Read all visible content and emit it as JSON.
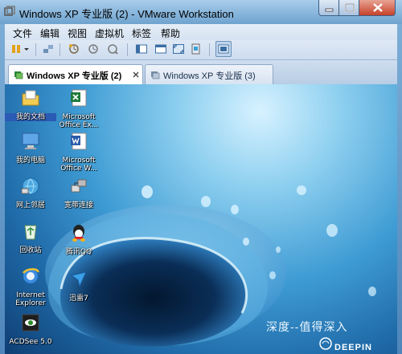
{
  "window": {
    "title": "Windows XP 专业版 (2) - VMware Workstation",
    "controls": {
      "minimize": "minimize",
      "maximize": "maximize",
      "close": "close"
    }
  },
  "menubar": {
    "items": [
      "文件",
      "编辑",
      "视图",
      "虚拟机",
      "标签",
      "帮助"
    ]
  },
  "toolbar": {
    "icons": [
      "power-icon",
      "dropdown-arrow-icon",
      "network-icon",
      "snapshot-take-icon",
      "snapshot-revert-icon",
      "snapshot-manager-icon",
      "normal-view-icon",
      "quick-switch-icon",
      "full-screen-icon",
      "unity-icon",
      "console-view-icon"
    ]
  },
  "tabs": [
    {
      "label": "Windows XP 专业版 (2)",
      "active": true
    },
    {
      "label": "Windows XP 专业版 (3)",
      "active": false
    }
  ],
  "desktop": {
    "icons": [
      {
        "label": "我的文档",
        "icon": "my-documents-icon",
        "selected": true
      },
      {
        "label": "Microsoft\nOffice Ex...",
        "icon": "excel-icon",
        "selected": false
      },
      {
        "label": "我的电脑",
        "icon": "my-computer-icon",
        "selected": false
      },
      {
        "label": "Microsoft\nOffice W...",
        "icon": "word-icon",
        "selected": false
      },
      {
        "label": "网上邻居",
        "icon": "network-places-icon",
        "selected": false
      },
      {
        "label": "宽带连接",
        "icon": "broadband-icon",
        "selected": false
      },
      {
        "label": "回收站",
        "icon": "recycle-bin-icon",
        "selected": false
      },
      {
        "label": "腾讯QQ",
        "icon": "qq-icon",
        "selected": false
      },
      {
        "label": "Internet\nExplorer",
        "icon": "ie-icon",
        "selected": false
      },
      {
        "label": "迅雷7",
        "icon": "xunlei-icon",
        "selected": false
      },
      {
        "label": "ACDSee 5.0",
        "icon": "acdsee-icon",
        "selected": false
      }
    ],
    "slogan": "深度--值得深入",
    "brand": "DEEPIN"
  },
  "colors": {
    "titlebar": "#8fbde2",
    "close_button": "#c6412b",
    "desktop_deep": "#0f3f74",
    "desktop_light": "#8fd0f0"
  }
}
